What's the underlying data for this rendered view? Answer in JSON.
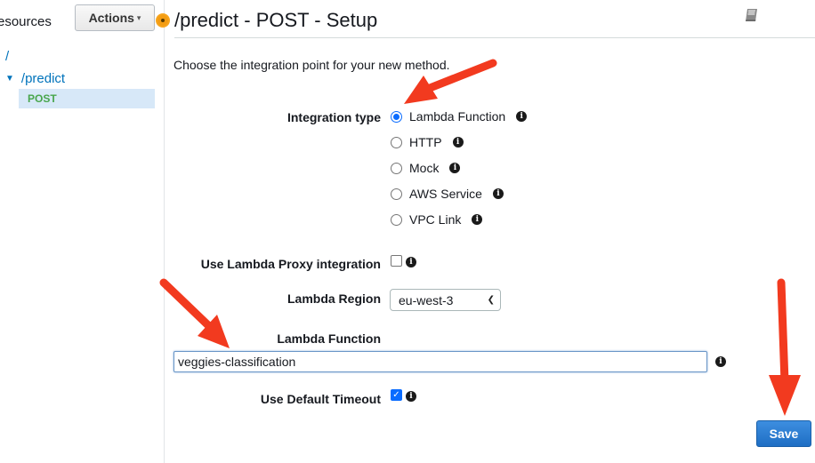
{
  "sidebar": {
    "title": "esources",
    "actions_label": "Actions",
    "tree": {
      "root": "/",
      "predict": "/predict",
      "method": "POST"
    }
  },
  "header": {
    "title": "/predict - POST - Setup"
  },
  "form": {
    "intro": "Choose the integration point for your new method.",
    "integration_type_label": "Integration type",
    "integration_options": [
      {
        "label": "Lambda Function",
        "selected": true
      },
      {
        "label": "HTTP",
        "selected": false
      },
      {
        "label": "Mock",
        "selected": false
      },
      {
        "label": "AWS Service",
        "selected": false
      },
      {
        "label": "VPC Link",
        "selected": false
      }
    ],
    "proxy_label": "Use Lambda Proxy integration",
    "proxy_checked": false,
    "region_label": "Lambda Region",
    "region_value": "eu-west-3",
    "function_label": "Lambda Function",
    "function_value": "veggies-classification",
    "timeout_label": "Use Default Timeout",
    "timeout_checked": true,
    "save_label": "Save"
  },
  "colors": {
    "accent": "#0a6cff",
    "link": "#0073bb",
    "method": "#49a64d",
    "save_button": "#1e6ec4",
    "annotation_arrow": "#f23a1f"
  }
}
